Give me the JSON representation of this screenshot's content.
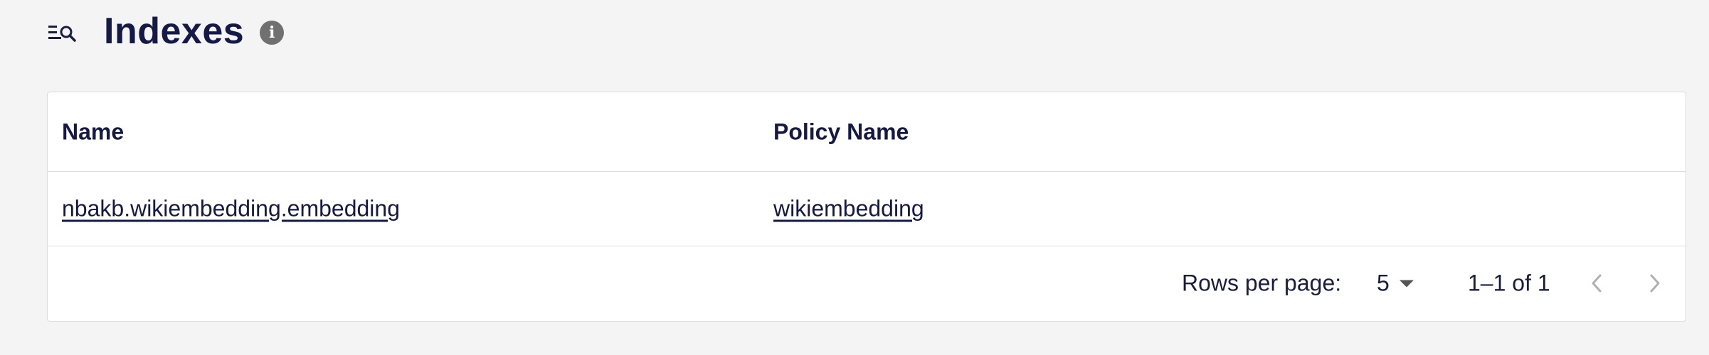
{
  "header": {
    "title": "Indexes",
    "title_icon": "list-search-icon",
    "info_icon": "info-icon",
    "info_glyph": "i"
  },
  "table": {
    "columns": [
      "Name",
      "Policy Name"
    ],
    "rows": [
      {
        "name": "nbakb.wikiembedding.embedding",
        "policy_name": "wikiembedding"
      }
    ]
  },
  "pagination": {
    "rows_per_page_label": "Rows per page:",
    "rows_per_page_value": "5",
    "range_text": "1–1 of 1",
    "prev_icon": "chevron-left-icon",
    "next_icon": "chevron-right-icon"
  },
  "colors": {
    "background": "#f4f4f4",
    "text": "#141a45",
    "border": "#dcdcdc",
    "info_icon_bg": "#707070",
    "disabled_icon": "#b0b0b0"
  }
}
